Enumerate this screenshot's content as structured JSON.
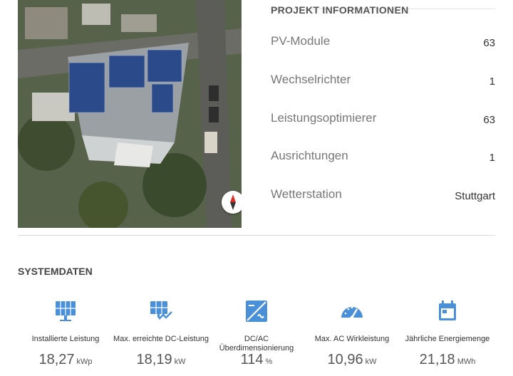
{
  "project": {
    "title": "PROJEKT INFORMATIONEN",
    "rows": [
      {
        "label": "PV-Module",
        "value": "63"
      },
      {
        "label": "Wechselrichter",
        "value": "1"
      },
      {
        "label": "Leistungsoptimierer",
        "value": "63"
      },
      {
        "label": "Ausrichtungen",
        "value": "1"
      },
      {
        "label": "Wetterstation",
        "value": "Stuttgart"
      }
    ]
  },
  "system": {
    "title": "SYSTEMDATEN",
    "stats": [
      {
        "label": "Installierte Leistung",
        "value": "18,27",
        "unit": "kWp",
        "icon": "solar-panel-icon"
      },
      {
        "label": "Max. erreichte DC-Leistung",
        "value": "18,19",
        "unit": "kW",
        "icon": "solar-panel-chart-icon"
      },
      {
        "label": "DC/AC Überdimensionierung",
        "value": "114",
        "unit": "%",
        "icon": "dc-ac-converter-icon"
      },
      {
        "label": "Max. AC Wirkleistung",
        "value": "10,96",
        "unit": "kW",
        "icon": "speedometer-icon"
      },
      {
        "label": "Jährliche Energiemenge",
        "value": "21,18",
        "unit": "MWh",
        "icon": "calendar-icon"
      }
    ]
  },
  "colors": {
    "icon": "#4a90d9",
    "map_roof": "#2b4a8a"
  }
}
